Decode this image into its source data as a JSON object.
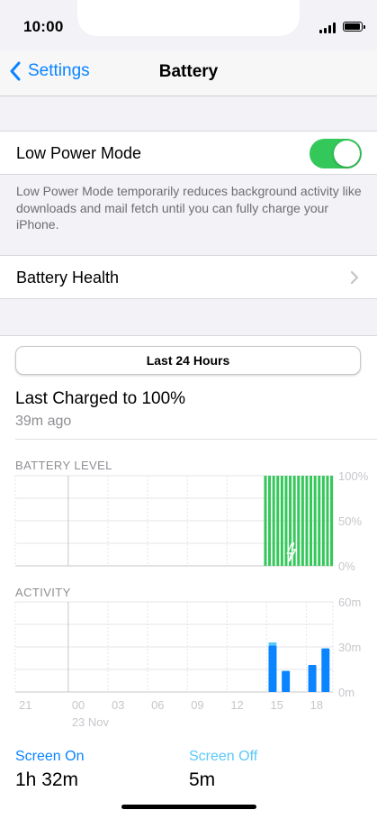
{
  "status_bar": {
    "time": "10:00"
  },
  "nav": {
    "back_label": "Settings",
    "title": "Battery"
  },
  "low_power": {
    "label": "Low Power Mode",
    "enabled": true,
    "footnote": "Low Power Mode temporarily reduces background activity like downloads and mail fetch until you can fully charge your iPhone."
  },
  "battery_health": {
    "label": "Battery Health"
  },
  "usage": {
    "segment_label": "Last 24 Hours",
    "last_charged_title": "Last Charged to 100%",
    "last_charged_ago": "39m ago",
    "screen_on_label": "Screen On",
    "screen_on_value": "1h 32m",
    "screen_off_label": "Screen Off",
    "screen_off_value": "5m"
  },
  "colors": {
    "accent": "#0a84ff",
    "toggle_on": "#34c759",
    "battery_green": "#34c759",
    "activity_screen_on": "#0a84ff",
    "activity_screen_off": "#5ac8fa"
  },
  "chart_data": [
    {
      "type": "bar",
      "title": "BATTERY LEVEL",
      "ylim": [
        0,
        100
      ],
      "y_ticks": [
        "100%",
        "50%",
        "0%"
      ],
      "x_ticks": [
        "21",
        "00",
        "03",
        "06",
        "09",
        "12",
        "15",
        "18"
      ],
      "x_subtitle": "23 Nov",
      "series": [
        {
          "values": [
            100,
            100,
            100,
            100,
            100,
            100,
            100,
            100,
            100,
            100,
            100,
            100,
            100,
            100,
            100,
            100,
            100,
            100,
            100,
            100
          ]
        }
      ],
      "charging_icon": "lightning-icon"
    },
    {
      "type": "bar",
      "title": "ACTIVITY",
      "ylim": [
        0,
        60
      ],
      "y_ticks": [
        "60m",
        "30m",
        "0m"
      ],
      "x_ticks": [
        "21",
        "00",
        "03",
        "06",
        "09",
        "12",
        "15",
        "18"
      ],
      "x_subtitle": "23 Nov",
      "series": [
        {
          "hours": [
            15,
            16,
            18,
            19
          ],
          "values": [
            31,
            14,
            18,
            29
          ]
        },
        {
          "hours": [
            15,
            16,
            18,
            19
          ],
          "values": [
            2,
            0,
            0,
            0
          ]
        }
      ]
    }
  ]
}
